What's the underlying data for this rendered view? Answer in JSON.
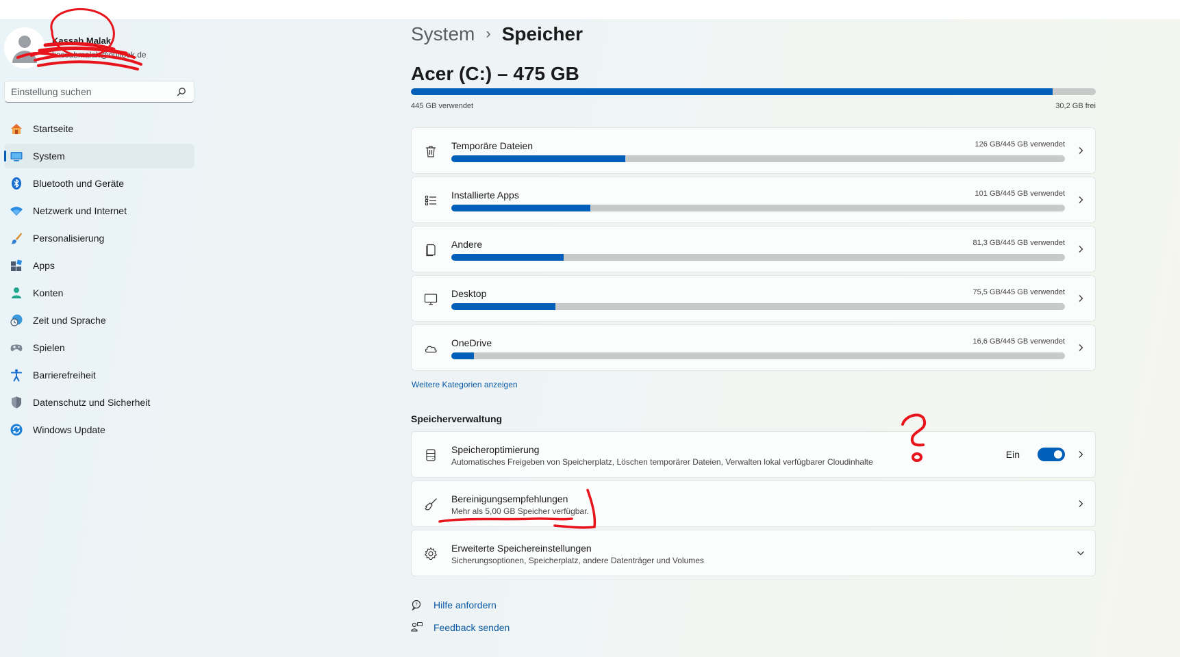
{
  "profile": {
    "name": "Kassab Malak",
    "email": "kassabmalak@outlook.de"
  },
  "search": {
    "placeholder": "Einstellung suchen"
  },
  "sidebar": {
    "items": [
      {
        "label": "Startseite",
        "icon": "home-icon"
      },
      {
        "label": "System",
        "icon": "system-icon",
        "active": true
      },
      {
        "label": "Bluetooth und Geräte",
        "icon": "bluetooth-icon"
      },
      {
        "label": "Netzwerk und Internet",
        "icon": "wifi-icon"
      },
      {
        "label": "Personalisierung",
        "icon": "brush-icon"
      },
      {
        "label": "Apps",
        "icon": "apps-icon"
      },
      {
        "label": "Konten",
        "icon": "account-icon"
      },
      {
        "label": "Zeit und Sprache",
        "icon": "clock-globe-icon"
      },
      {
        "label": "Spielen",
        "icon": "gamepad-icon"
      },
      {
        "label": "Barrierefreiheit",
        "icon": "accessibility-icon"
      },
      {
        "label": "Datenschutz und Sicherheit",
        "icon": "shield-icon"
      },
      {
        "label": "Windows Update",
        "icon": "update-icon"
      }
    ]
  },
  "header": {
    "parent": "System",
    "separator": "›",
    "current": "Speicher"
  },
  "drive": {
    "title": "Acer (C:) – 475 GB",
    "used_label": "445 GB verwendet",
    "free_label": "30,2 GB frei",
    "used_fraction": 0.937
  },
  "categories": [
    {
      "name": "Temporäre Dateien",
      "usage": "126 GB/445 GB verwendet",
      "fraction": 0.283,
      "icon": "trash-icon"
    },
    {
      "name": "Installierte Apps",
      "usage": "101 GB/445 GB verwendet",
      "fraction": 0.227,
      "icon": "app-list-icon"
    },
    {
      "name": "Andere",
      "usage": "81,3 GB/445 GB verwendet",
      "fraction": 0.183,
      "icon": "document-icon"
    },
    {
      "name": "Desktop",
      "usage": "75,5 GB/445 GB verwendet",
      "fraction": 0.17,
      "icon": "monitor-icon"
    },
    {
      "name": "OneDrive",
      "usage": "16,6 GB/445 GB verwendet",
      "fraction": 0.037,
      "icon": "cloud-icon"
    }
  ],
  "more_categories": "Weitere Kategorien anzeigen",
  "management": {
    "title": "Speicherverwaltung",
    "items": [
      {
        "title": "Speicheroptimierung",
        "desc": "Automatisches Freigeben von Speicherplatz, Löschen temporärer Dateien, Verwalten lokal verfügbarer Cloudinhalte",
        "toggle_label": "Ein",
        "toggle_on": true,
        "icon": "storage-drive-icon"
      },
      {
        "title": "Bereinigungsempfehlungen",
        "desc": "Mehr als 5,00 GB Speicher verfügbar.",
        "icon": "broom-icon"
      },
      {
        "title": "Erweiterte Speichereinstellungen",
        "desc": "Sicherungsoptionen, Speicherplatz, andere Datenträger und Volumes",
        "icon": "gear-icon"
      }
    ]
  },
  "help": {
    "get_help": "Hilfe anfordern",
    "feedback": "Feedback senden"
  },
  "colors": {
    "accent": "#005fb8",
    "bar_track": "#c8c9c9",
    "annotation": "#e8141c"
  }
}
